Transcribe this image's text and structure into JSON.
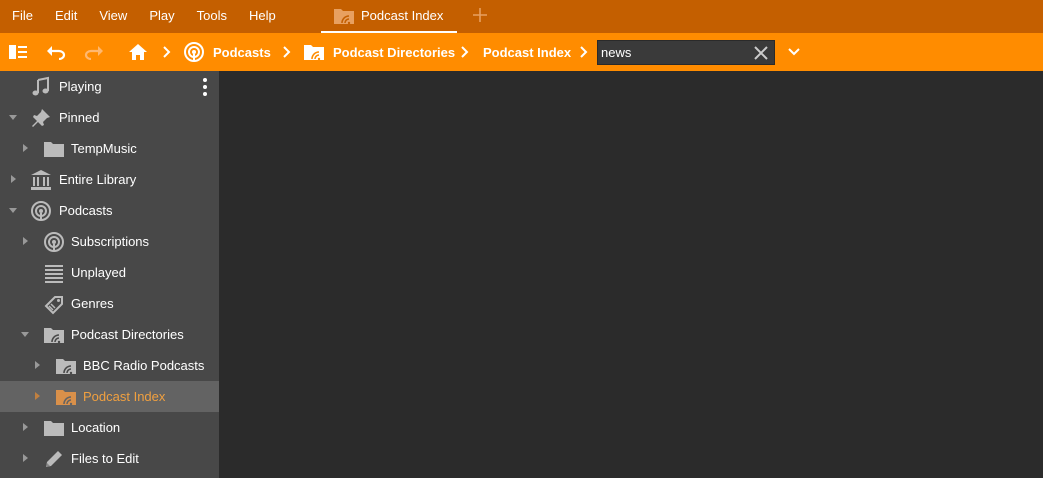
{
  "menu": [
    "File",
    "Edit",
    "View",
    "Play",
    "Tools",
    "Help"
  ],
  "tab": {
    "label": "Podcast Index"
  },
  "breadcrumb": [
    "Podcasts",
    "Podcast Directories",
    "Podcast Index"
  ],
  "search": {
    "value": "news"
  },
  "sidebar": {
    "items": [
      {
        "label": "Playing",
        "icon": "music-note-icon"
      },
      {
        "label": "Pinned",
        "icon": "pin-icon"
      },
      {
        "label": "TempMusic",
        "icon": "folder-icon"
      },
      {
        "label": "Entire Library",
        "icon": "library-icon"
      },
      {
        "label": "Podcasts",
        "icon": "podcast-icon"
      },
      {
        "label": "Subscriptions",
        "icon": "podcast-icon"
      },
      {
        "label": "Unplayed",
        "icon": "list-icon"
      },
      {
        "label": "Genres",
        "icon": "tag-icon"
      },
      {
        "label": "Podcast Directories",
        "icon": "podcast-folder-icon"
      },
      {
        "label": "BBC Radio Podcasts",
        "icon": "podcast-folder-icon"
      },
      {
        "label": "Podcast Index",
        "icon": "podcast-folder-icon"
      },
      {
        "label": "Location",
        "icon": "folder-icon"
      },
      {
        "label": "Files to Edit",
        "icon": "pencil-icon"
      }
    ]
  },
  "colors": {
    "menubar": "#c45f00",
    "toolbar": "#ff8c00",
    "sidebar": "#484848",
    "selected_text": "#f0a040",
    "content": "#2b2b2b"
  }
}
